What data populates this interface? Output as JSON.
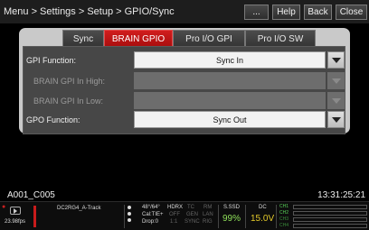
{
  "breadcrumb": "Menu > Settings > Setup > GPIO/Sync",
  "title_buttons": {
    "dots": "...",
    "help": "Help",
    "back": "Back",
    "close": "Close"
  },
  "tabs": [
    {
      "label": "Sync",
      "active": false
    },
    {
      "label": "BRAIN GPIO",
      "active": true
    },
    {
      "label": "Pro I/O GPI",
      "active": false
    },
    {
      "label": "Pro I/O SW",
      "active": false
    }
  ],
  "fields": {
    "gpi_function": {
      "label": "GPI Function:",
      "value": "Sync In"
    },
    "brain_gpi_in_high": {
      "label": "BRAIN GPI In High:",
      "value": ""
    },
    "brain_gpi_in_low": {
      "label": "BRAIN GPI In Low:",
      "value": ""
    },
    "gpo_function": {
      "label": "GPO Function:",
      "value": "Sync Out"
    }
  },
  "clip_name": "A001_C005",
  "timecode": "13:31:25:21",
  "status": {
    "fps": "23.98fps",
    "codec": "DC2RG4_A-Track",
    "shutter": "48°/64°",
    "hdrx": "HDRX",
    "tc": "TC",
    "rm": "RM",
    "cal": "Cal:TIE+",
    "off": "OFF",
    "gen": "GEN",
    "lan": "LAN",
    "drop": "Drop:0",
    "ratio": "1:1",
    "sync": "SYNC",
    "rig": "RIG",
    "media": "S.SSD",
    "media_pct": "99%",
    "power": "DC",
    "voltage": "15.0V",
    "channels": [
      "CH1",
      "CH2",
      "CH3",
      "CH4"
    ]
  }
}
